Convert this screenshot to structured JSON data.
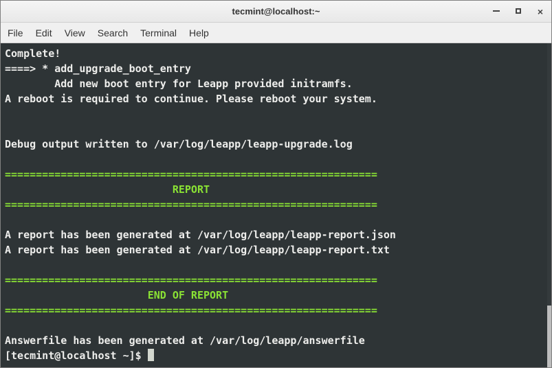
{
  "window": {
    "title": "tecmint@localhost:~"
  },
  "menu": {
    "file": "File",
    "edit": "Edit",
    "view": "View",
    "search": "Search",
    "terminal": "Terminal",
    "help": "Help"
  },
  "terminal": {
    "line1": "Complete!",
    "line2": "====> * add_upgrade_boot_entry",
    "line3": "        Add new boot entry for Leapp provided initramfs.",
    "line4": "A reboot is required to continue. Please reboot your system.",
    "line5": "",
    "line6": "",
    "line7": "Debug output written to /var/log/leapp/leapp-upgrade.log",
    "line8": "",
    "sep1": "============================================================",
    "report_header": "                           REPORT",
    "sep2": "============================================================",
    "line9": "",
    "line10": "A report has been generated at /var/log/leapp/leapp-report.json",
    "line11": "A report has been generated at /var/log/leapp/leapp-report.txt",
    "line12": "",
    "sep3": "============================================================",
    "end_report": "                       END OF REPORT",
    "sep4": "============================================================",
    "line13": "",
    "line14": "Answerfile has been generated at /var/log/leapp/answerfile",
    "prompt": "[tecmint@localhost ~]$ "
  }
}
